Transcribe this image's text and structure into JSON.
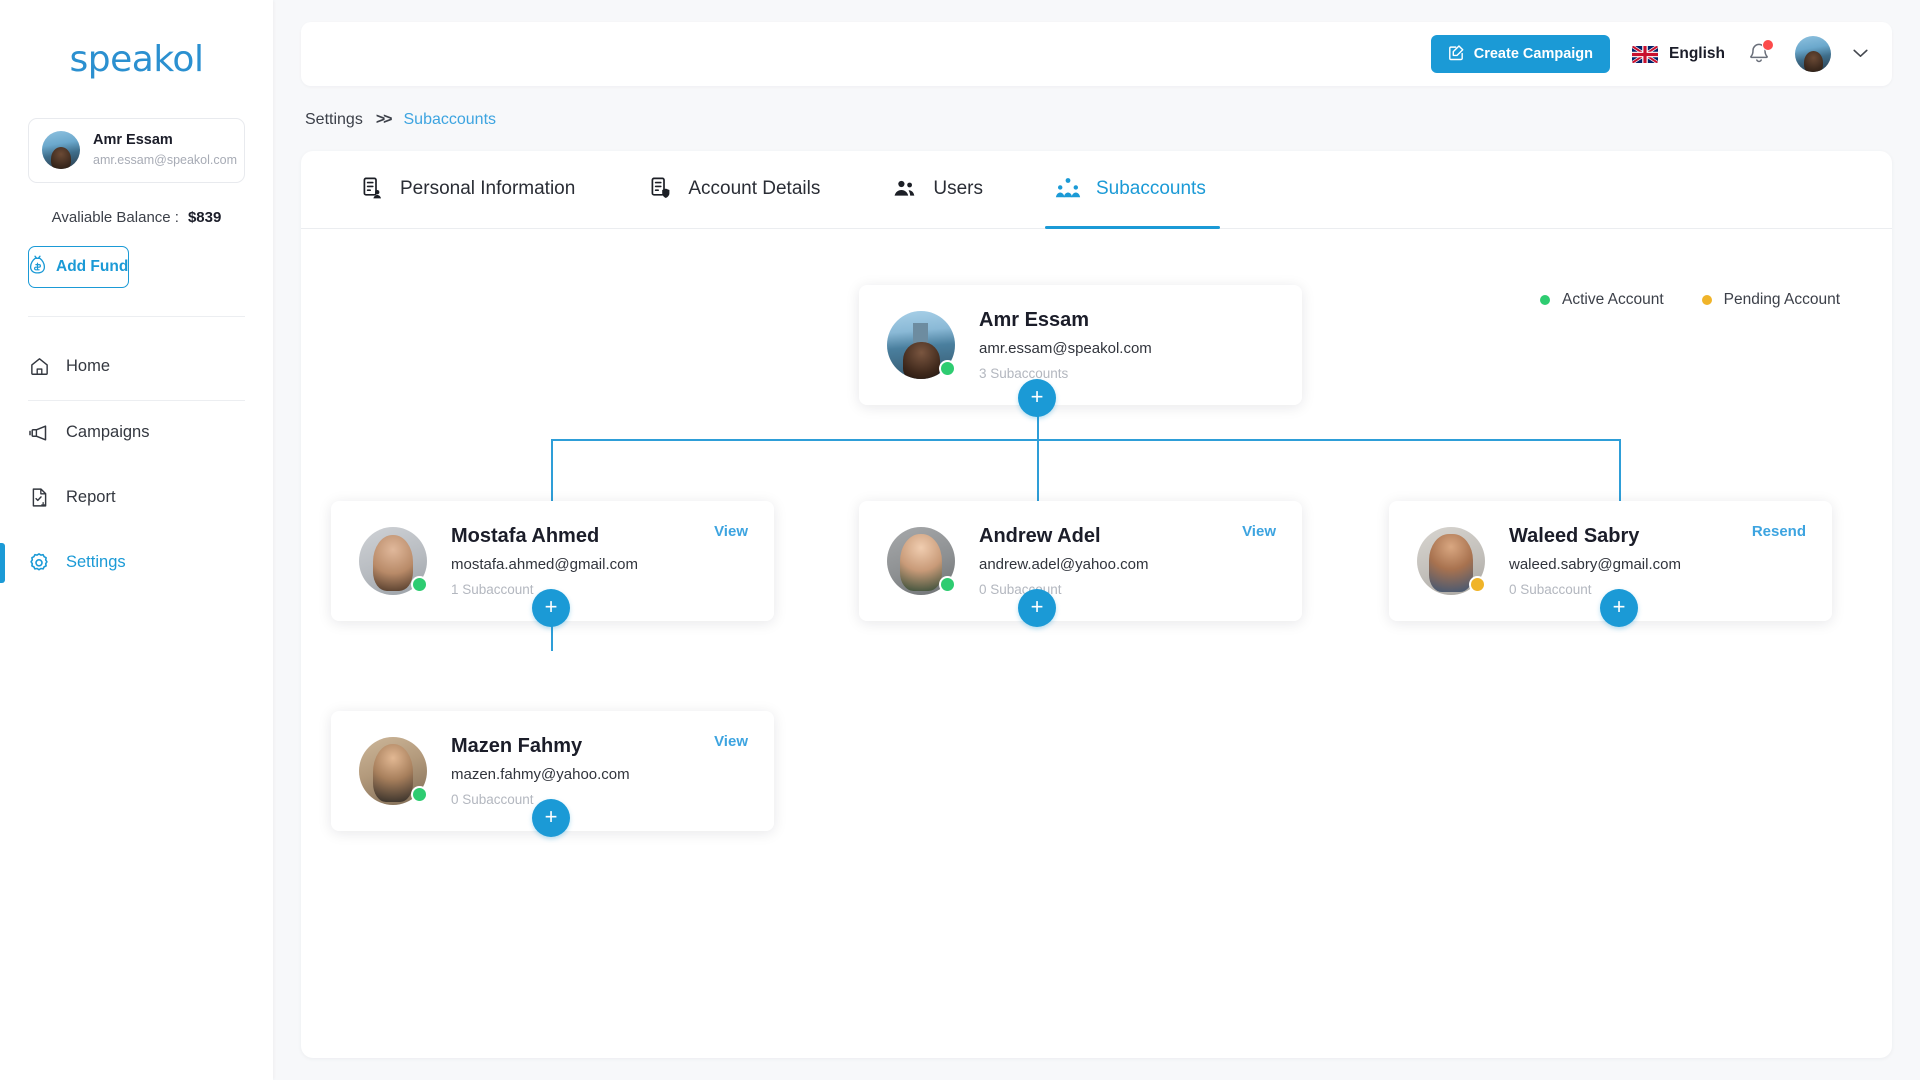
{
  "brand": {
    "logo_text": "speakol",
    "accent": "#1b9ad6"
  },
  "sidebar": {
    "profile": {
      "name": "Amr Essam",
      "email": "amr.essam@speakol.com"
    },
    "balance_label": "Avaliable Balance :",
    "balance_value": "$839",
    "add_fund_label": "Add Fund",
    "nav": [
      {
        "label": "Home",
        "icon": "home-icon",
        "active": false
      },
      {
        "label": "Campaigns",
        "icon": "megaphone-icon",
        "active": false
      },
      {
        "label": "Report",
        "icon": "report-document-icon",
        "active": false
      },
      {
        "label": "Settings",
        "icon": "gear-icon",
        "active": true
      }
    ]
  },
  "header": {
    "create_campaign_label": "Create Campaign",
    "language": "English",
    "language_flag": "uk-flag-icon",
    "notification_badge": true
  },
  "breadcrumb": {
    "root": "Settings",
    "separator": ">>",
    "current": "Subaccounts"
  },
  "tabs": [
    {
      "label": "Personal Information",
      "icon": "person-card-icon",
      "active": false
    },
    {
      "label": "Account Details",
      "icon": "account-shield-icon",
      "active": false
    },
    {
      "label": "Users",
      "icon": "users-icon",
      "active": false
    },
    {
      "label": "Subaccounts",
      "icon": "subaccounts-icon",
      "active": true
    }
  ],
  "legend": [
    {
      "label": "Active Account",
      "color": "#2ecc71"
    },
    {
      "label": "Pending Account",
      "color": "#f0b429"
    }
  ],
  "tree": {
    "root": {
      "name": "Amr Essam",
      "email": "amr.essam@speakol.com",
      "subaccounts_text": "3 Subaccounts",
      "status": "active",
      "status_color": "#2ecc71",
      "action": "",
      "add_label": "+"
    },
    "children": [
      {
        "name": "Mostafa Ahmed",
        "email": "mostafa.ahmed@gmail.com",
        "subaccounts_text": "1 Subaccount",
        "status": "active",
        "status_color": "#2ecc71",
        "action": "View",
        "add_label": "+"
      },
      {
        "name": "Andrew Adel",
        "email": "andrew.adel@yahoo.com",
        "subaccounts_text": "0 Subaccount",
        "status": "active",
        "status_color": "#2ecc71",
        "action": "View",
        "add_label": "+"
      },
      {
        "name": "Waleed Sabry",
        "email": "waleed.sabry@gmail.com",
        "subaccounts_text": "0 Subaccount",
        "status": "pending",
        "status_color": "#f0b429",
        "action": "Resend",
        "add_label": "+"
      }
    ],
    "grandchildren": [
      {
        "name": "Mazen Fahmy",
        "email": "mazen.fahmy@yahoo.com",
        "subaccounts_text": "0 Subaccount",
        "status": "active",
        "status_color": "#2ecc71",
        "action": "View",
        "add_label": "+"
      }
    ]
  }
}
